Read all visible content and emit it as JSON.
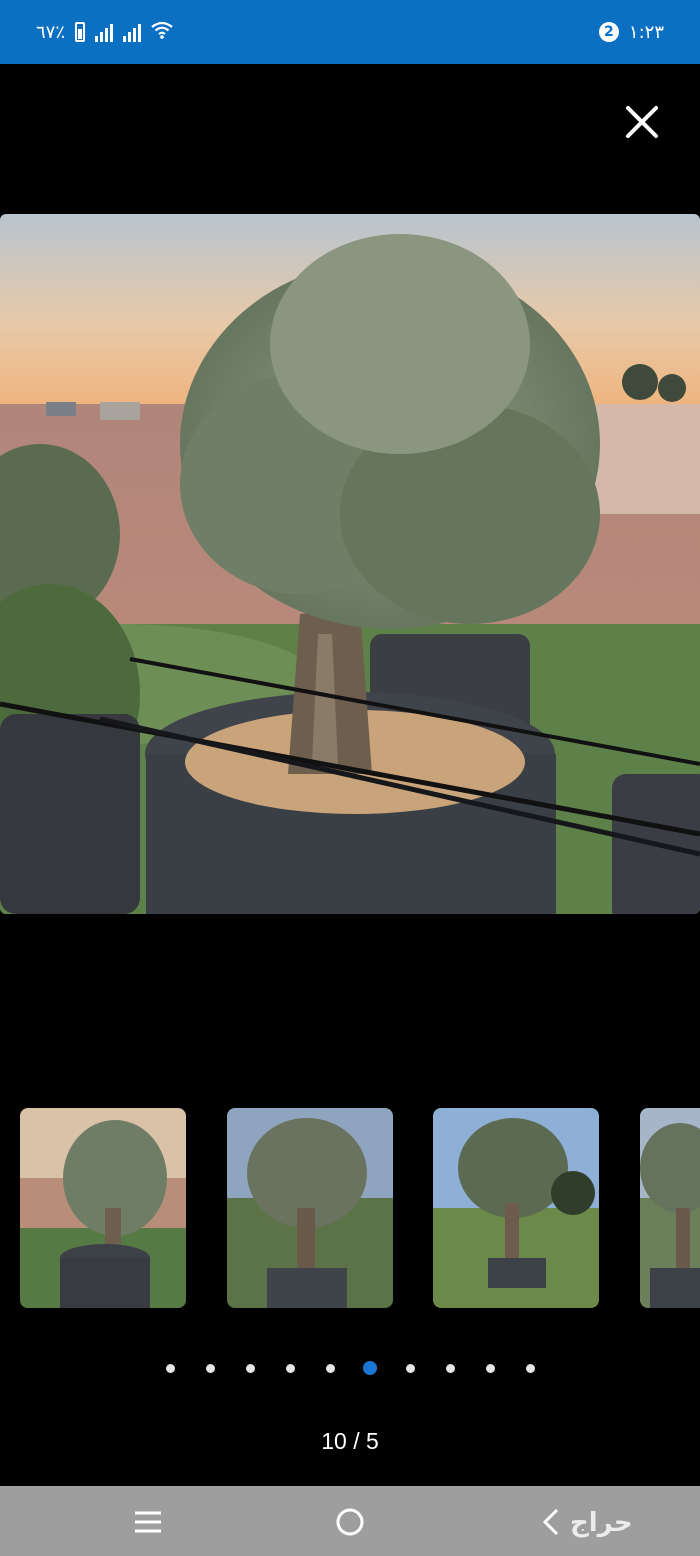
{
  "status_bar": {
    "battery_text": "٦٧٪",
    "time": "١:٢٣",
    "notification_count": "2",
    "icons": [
      "battery-icon",
      "signal-icon",
      "signal-icon",
      "wifi-icon"
    ]
  },
  "viewer": {
    "close_icon": "close-icon",
    "main_image": "olive-tree-in-grow-bag",
    "thumbnails": [
      {
        "image": "olive-tree-thumbnail-1"
      },
      {
        "image": "olive-tree-thumbnail-2"
      },
      {
        "image": "olive-tree-thumbnail-3"
      },
      {
        "image": "olive-tree-thumbnail-4"
      }
    ],
    "dots_count": 10,
    "active_dot_index": 5,
    "counter": "10 / 5"
  },
  "nav_bar": {
    "icons": [
      "menu-icon",
      "home-icon",
      "back-icon"
    ],
    "watermark": "حراج"
  },
  "colors": {
    "status_bar": "#0b6fc2",
    "active_dot": "#1976d2",
    "nav_bar": "#9e9e9e"
  }
}
